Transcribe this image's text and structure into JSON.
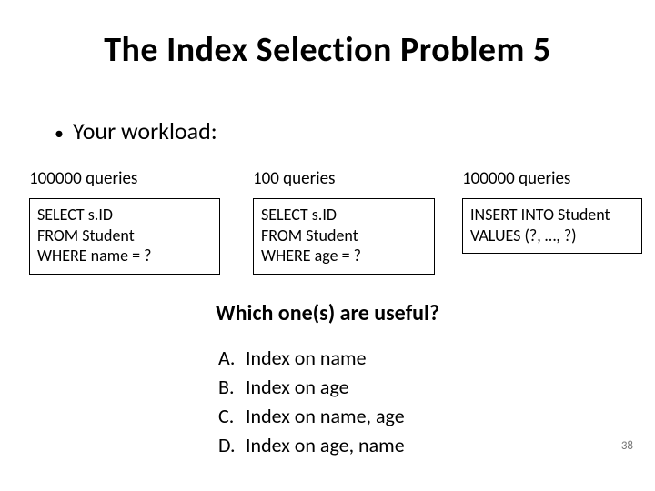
{
  "title": "The  Index  Selection  Problem  5",
  "bullet_text": "Your  workload:",
  "columns": [
    {
      "count": "100000  queries",
      "code_l1": "SELECT s.ID",
      "code_l2": "FROM Student",
      "code_l3": "WHERE  name = ?"
    },
    {
      "count": "100  queries",
      "code_l1": "SELECT s.ID",
      "code_l2": "FROM Student",
      "code_l3": "WHERE  age = ?"
    },
    {
      "count": "100000  queries",
      "code_l1": "INSERT INTO Student",
      "code_l2": "VALUES (?, …, ?)",
      "code_l3": ""
    }
  ],
  "question": "Which  one(s)  are  useful?",
  "options": [
    {
      "letter": "A.",
      "text": "Index  on  name"
    },
    {
      "letter": "B.",
      "text": "Index  on  age"
    },
    {
      "letter": "C.",
      "text": "Index  on  name,  age"
    },
    {
      "letter": "D.",
      "text": "Index  on  age,  name"
    }
  ],
  "page_number": "38"
}
